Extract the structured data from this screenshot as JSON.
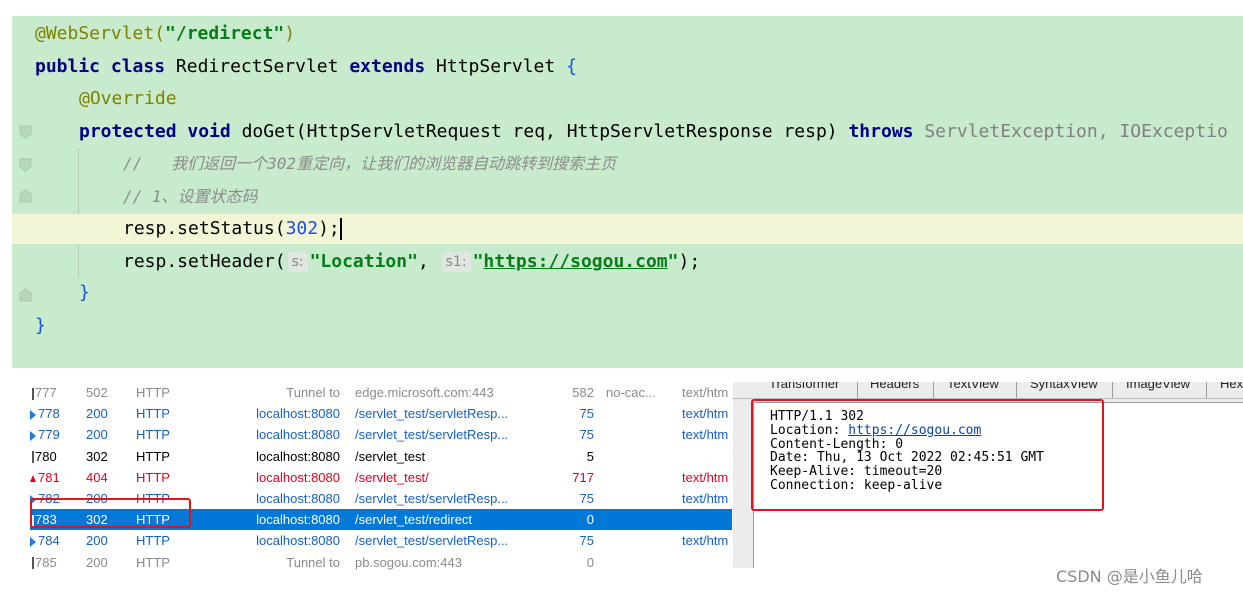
{
  "editor": {
    "line1": {
      "annotation": "@WebServlet(",
      "path": "\"/redirect\"",
      "close": ")"
    },
    "line2": {
      "kw_public": "public",
      "kw_class": "class",
      "class_name": "RedirectServlet",
      "kw_extends": "extends",
      "super_name": "HttpServlet",
      "brace": "{"
    },
    "line3": {
      "annotation": "@Override"
    },
    "line4": {
      "kw_protected": "protected",
      "kw_void": "void",
      "signature": "doGet(HttpServletRequest req, HttpServletResponse resp)",
      "kw_throws": "throws",
      "exceptions": "ServletException, IOExceptio"
    },
    "line5": {
      "comment": "//   我们返回一个302重定向，让我们的浏览器自动跳转到搜索主页"
    },
    "line6": {
      "comment": "// 1、设置状态码"
    },
    "line7": {
      "call": "resp.setStatus(",
      "arg": "302",
      "close": ");"
    },
    "line8": {
      "call": "resp.setHeader(",
      "hint_s": "s:",
      "header_name": "\"Location\"",
      "comma": ",",
      "hint_s1": "s1:",
      "quote_open": "\"",
      "url": "https://sogou.com",
      "quote_close": "\"",
      "close": ");"
    },
    "line9": {
      "brace": "}"
    },
    "line10": {
      "brace": "}"
    }
  },
  "sessions": [
    {
      "id": "777",
      "result": "502",
      "protocol": "HTTP",
      "host": "Tunnel to",
      "url": "edge.microsoft.com:443",
      "body": "582",
      "caching": "no-cac...",
      "content_type": "text/htm",
      "style": "gray",
      "marker": "pipe"
    },
    {
      "id": "778",
      "result": "200",
      "protocol": "HTTP",
      "host": "localhost:8080",
      "url": "/servlet_test/servletResp...",
      "body": "75",
      "caching": "",
      "content_type": "text/htm",
      "style": "blue",
      "marker": "play"
    },
    {
      "id": "779",
      "result": "200",
      "protocol": "HTTP",
      "host": "localhost:8080",
      "url": "/servlet_test/servletResp...",
      "body": "75",
      "caching": "",
      "content_type": "text/htm",
      "style": "blue",
      "marker": "play"
    },
    {
      "id": "780",
      "result": "302",
      "protocol": "HTTP",
      "host": "localhost:8080",
      "url": "/servlet_test",
      "body": "5",
      "caching": "",
      "content_type": "",
      "style": "black",
      "marker": "pipe"
    },
    {
      "id": "781",
      "result": "404",
      "protocol": "HTTP",
      "host": "localhost:8080",
      "url": "/servlet_test/",
      "body": "717",
      "caching": "",
      "content_type": "text/htm",
      "style": "red",
      "marker": "err"
    },
    {
      "id": "782",
      "result": "200",
      "protocol": "HTTP",
      "host": "localhost:8080",
      "url": "/servlet_test/servletResp...",
      "body": "75",
      "caching": "",
      "content_type": "text/htm",
      "style": "blue",
      "marker": "play"
    },
    {
      "id": "783",
      "result": "302",
      "protocol": "HTTP",
      "host": "localhost:8080",
      "url": "/servlet_test/redirect",
      "body": "0",
      "caching": "",
      "content_type": "",
      "style": "sel",
      "marker": "pipe"
    },
    {
      "id": "784",
      "result": "200",
      "protocol": "HTTP",
      "host": "localhost:8080",
      "url": "/servlet_test/servletResp...",
      "body": "75",
      "caching": "",
      "content_type": "text/htm",
      "style": "blue",
      "marker": "play"
    },
    {
      "id": "785",
      "result": "200",
      "protocol": "HTTP",
      "host": "Tunnel to",
      "url": "pb.sogou.com:443",
      "body": "0",
      "caching": "",
      "content_type": "",
      "style": "gray",
      "marker": "pipe"
    }
  ],
  "inspector": {
    "tabs": [
      "Transformer",
      "Headers",
      "TextView",
      "SyntaxView",
      "ImageView",
      "Hex"
    ],
    "response": {
      "status_line": "HTTP/1.1 302",
      "location_label": "Location: ",
      "location_url": "https://sogou.com",
      "content_length": "Content-Length: 0",
      "date": "Date: Thu, 13 Oct 2022 02:45:51 GMT",
      "keep_alive": "Keep-Alive: timeout=20",
      "connection": "Connection: keep-alive"
    }
  },
  "watermark": "CSDN @是小鱼儿哈",
  "colors": {
    "editor_bg": "#c7ebcc",
    "keyword": "#000080",
    "string": "#067d17",
    "number": "#1750eb",
    "annotation": "#808000",
    "selection": "#0078d7",
    "highlight_box": "#e0151b"
  }
}
